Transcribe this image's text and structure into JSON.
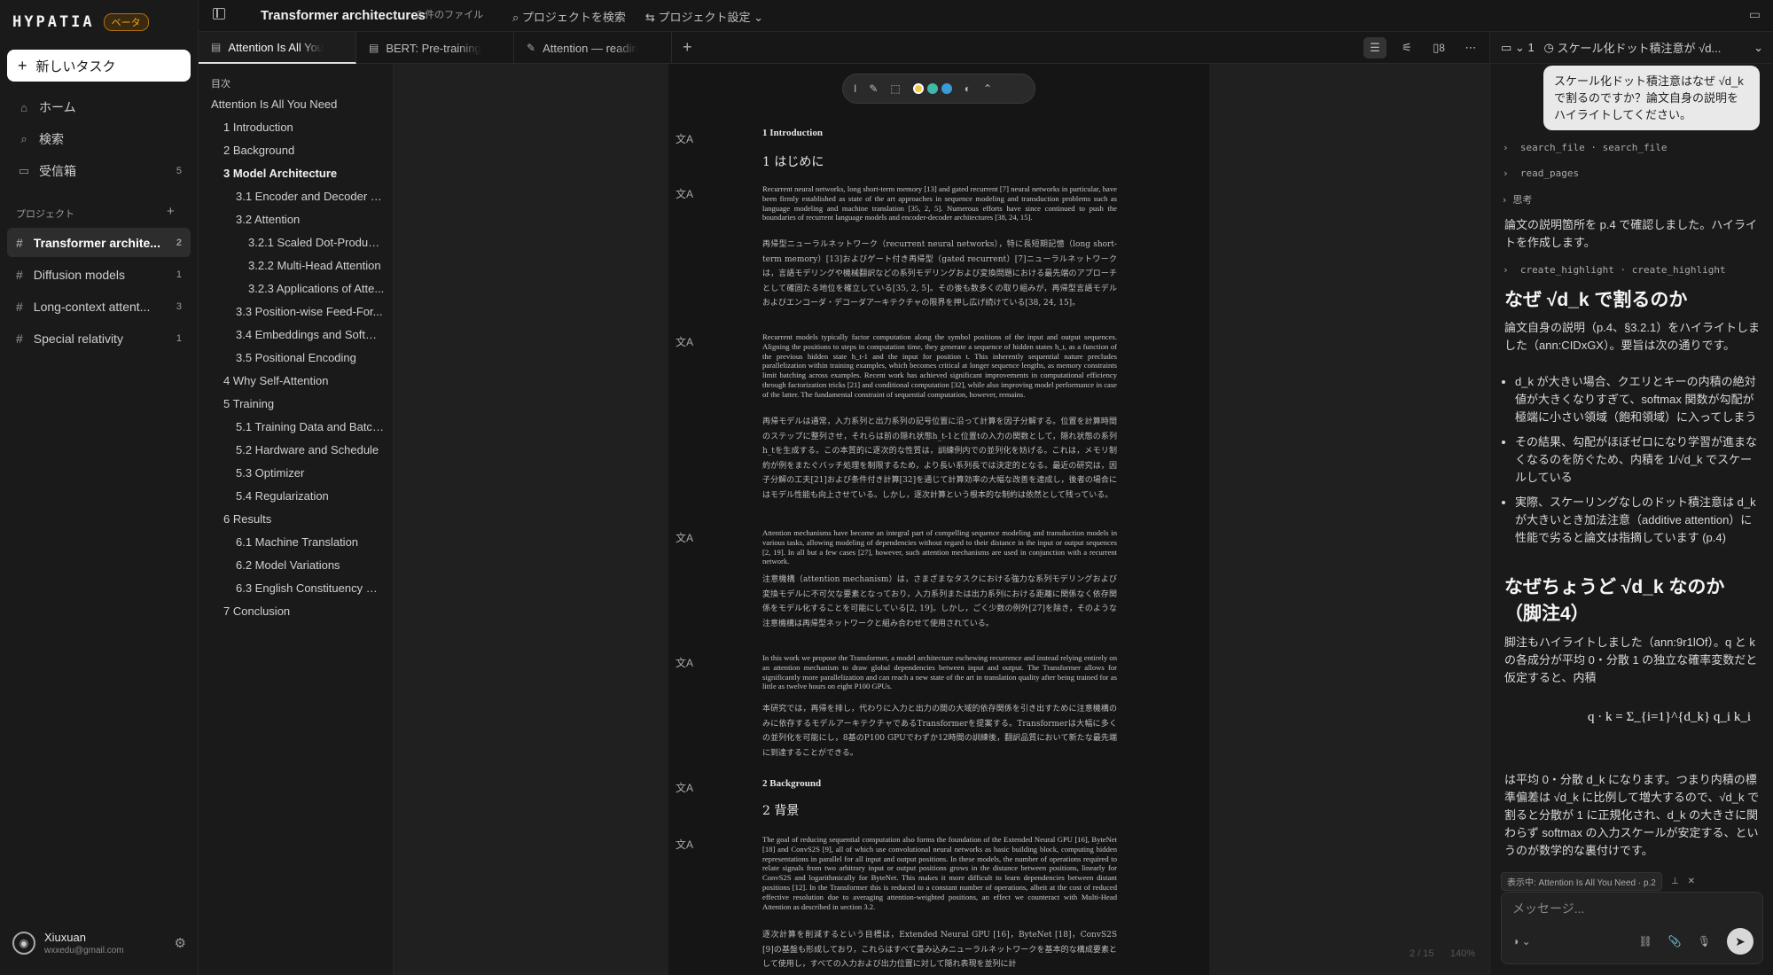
{
  "app": {
    "logo": "HYPATIA",
    "beta_badge": "ベータ"
  },
  "sidebar": {
    "new_task": "新しいタスク",
    "nav": [
      {
        "label": "ホーム",
        "icon": "home-icon"
      },
      {
        "label": "検索",
        "icon": "search-icon"
      },
      {
        "label": "受信箱",
        "icon": "inbox-icon",
        "count": "5"
      }
    ],
    "projects_label": "プロジェクト",
    "projects": [
      {
        "name": "Transformer archite...",
        "count": "2",
        "active": true
      },
      {
        "name": "Diffusion models",
        "count": "1"
      },
      {
        "name": "Long-context attent...",
        "count": "3"
      },
      {
        "name": "Special relativity",
        "count": "1"
      }
    ],
    "user": {
      "name": "Xiuxuan",
      "email": "wxxedu@gmail.com"
    }
  },
  "topbar": {
    "title": "Transformer architectures",
    "files": "2 件のファイル",
    "search": "プロジェクトを検索",
    "settings": "プロジェクト設定"
  },
  "tabs": [
    {
      "label": "Attention Is All You Need",
      "active": true
    },
    {
      "label": "BERT: Pre-training of Deep"
    },
    {
      "label": "Attention — reading notes"
    }
  ],
  "tab_tools": {
    "count": "8"
  },
  "toc": {
    "title": "目次",
    "items": [
      {
        "label": "Attention Is All You Need",
        "level": 0
      },
      {
        "label": "1 Introduction",
        "level": 1
      },
      {
        "label": "2 Background",
        "level": 1
      },
      {
        "label": "3 Model Architecture",
        "level": 1,
        "bold": true
      },
      {
        "label": "3.1 Encoder and Decoder St...",
        "level": 2
      },
      {
        "label": "3.2 Attention",
        "level": 2
      },
      {
        "label": "3.2.1 Scaled Dot-Product ...",
        "level": 3
      },
      {
        "label": "3.2.2 Multi-Head Attention",
        "level": 3
      },
      {
        "label": "3.2.3 Applications of Atte...",
        "level": 3
      },
      {
        "label": "3.3 Position-wise Feed-For...",
        "level": 2
      },
      {
        "label": "3.4 Embeddings and Softmax",
        "level": 2
      },
      {
        "label": "3.5 Positional Encoding",
        "level": 2
      },
      {
        "label": "4 Why Self-Attention",
        "level": 1
      },
      {
        "label": "5 Training",
        "level": 1
      },
      {
        "label": "5.1 Training Data and Batchi...",
        "level": 2
      },
      {
        "label": "5.2 Hardware and Schedule",
        "level": 2
      },
      {
        "label": "5.3 Optimizer",
        "level": 2
      },
      {
        "label": "5.4 Regularization",
        "level": 2
      },
      {
        "label": "6 Results",
        "level": 1
      },
      {
        "label": "6.1 Machine Translation",
        "level": 2
      },
      {
        "label": "6.2 Model Variations",
        "level": 2
      },
      {
        "label": "6.3 English Constituency Pa...",
        "level": 2
      },
      {
        "label": "7 Conclusion",
        "level": 1
      }
    ]
  },
  "document": {
    "colors": [
      "#f2c94c",
      "#3fb8a8",
      "#3b9ad9"
    ],
    "page_indicator": "2 / 15",
    "zoom": "140%",
    "blocks": {
      "h1_en": "1   Introduction",
      "h1_ja": "1 はじめに",
      "p1_en": "Recurrent neural networks, long short-term memory [13] and gated recurrent [7] neural networks in particular, have been firmly established as state of the art approaches in sequence modeling and transduction problems such as language modeling and machine translation [35, 2, 5]. Numerous efforts have since continued to push the boundaries of recurrent language models and encoder-decoder architectures [38, 24, 15].",
      "p1_ja": "再帰型ニューラルネットワーク（recurrent neural networks），特に長短期記憶（long short-term memory）[13]およびゲート付き再帰型（gated recurrent）[7]ニューラルネットワークは，言語モデリングや機械翻訳などの系列モデリングおよび変換問題における最先端のアプローチとして確固たる地位を確立している[35, 2, 5]。その後も数多くの取り組みが，再帰型言語モデルおよびエンコーダ・デコーダアーキテクチャの限界を押し広げ続けている[38, 24, 15]。",
      "p2_en": "Recurrent models typically factor computation along the symbol positions of the input and output sequences. Aligning the positions to steps in computation time, they generate a sequence of hidden states h_t, as a function of the previous hidden state h_t-1 and the input for position t. This inherently sequential nature precludes parallelization within training examples, which becomes critical at longer sequence lengths, as memory constraints limit batching across examples. Recent work has achieved significant improvements in computational efficiency through factorization tricks [21] and conditional computation [32], while also improving model performance in case of the latter. The fundamental constraint of sequential computation, however, remains.",
      "p2_ja": "再帰モデルは通常，入力系列と出力系列の記号位置に沿って計算を因子分解する。位置を計算時間のステップに整列させ，それらは前の隠れ状態h_t-1と位置tの入力の関数として，隠れ状態の系列h_tを生成する。この本質的に逐次的な性質は，訓練例内での並列化を妨げる。これは，メモリ制約が例をまたぐバッチ処理を制限するため，より長い系列長では決定的となる。最近の研究は，因子分解の工夫[21]および条件付き計算[32]を通じて計算効率の大幅な改善を達成し，後者の場合にはモデル性能も向上させている。しかし，逐次計算という根本的な制約は依然として残っている。",
      "p3_en": "Attention mechanisms have become an integral part of compelling sequence modeling and transduction models in various tasks, allowing modeling of dependencies without regard to their distance in the input or output sequences [2, 19]. In all but a few cases [27], however, such attention mechanisms are used in conjunction with a recurrent network.",
      "p3_ja": "注意機構（attention mechanism）は，さまざまなタスクにおける強力な系列モデリングおよび変換モデルに不可欠な要素となっており，入力系列または出力系列における距離に関係なく依存関係をモデル化することを可能にしている[2, 19]。しかし，ごく少数の例外[27]を除き，そのような注意機構は再帰型ネットワークと組み合わせて使用されている。",
      "p4_en": "In this work we propose the Transformer, a model architecture eschewing recurrence and instead relying entirely on an attention mechanism to draw global dependencies between input and output. The Transformer allows for significantly more parallelization and can reach a new state of the art in translation quality after being trained for as little as twelve hours on eight P100 GPUs.",
      "p4_ja": "本研究では，再帰を排し，代わりに入力と出力の間の大域的依存関係を引き出すために注意機構のみに依存するモデルアーキテクチャであるTransformerを提案する。Transformerは大幅に多くの並列化を可能にし，8基のP100 GPUでわずか12時間の訓練後，翻訳品質において新たな最先端に到達することができる。",
      "h2_en": "2   Background",
      "h2_ja": "2 背景",
      "p5_en": "The goal of reducing sequential computation also forms the foundation of the Extended Neural GPU [16], ByteNet [18] and ConvS2S [9], all of which use convolutional neural networks as basic building block, computing hidden representations in parallel for all input and output positions. In these models, the number of operations required to relate signals from two arbitrary input or output positions grows in the distance between positions, linearly for ConvS2S and logarithmically for ByteNet. This makes it more difficult to learn dependencies between distant positions [12]. In the Transformer this is reduced to a constant number of operations, albeit at the cost of reduced effective resolution due to averaging attention-weighted positions, an effect we counteract with Multi-Head Attention as described in section 3.2.",
      "p5_ja": "逐次計算を削減するという目標は，Extended Neural GPU [16]，ByteNet [18]，ConvS2S [9]の基盤も形成しており，これらはすべて畳み込みニューラルネットワークを基本的な構成要素として使用し，すべての入力および出力位置に対して隠れ表現を並列に計"
    }
  },
  "chat": {
    "header": {
      "count": "1",
      "thread_title": "スケール化ドット積注意が √d..."
    },
    "user_message": "スケール化ドット積注意はなぜ √d_k で割るのですか？論文自身の説明をハイライトしてください。",
    "tools": [
      {
        "label": "search_file · search_file"
      },
      {
        "label": "read_pages"
      },
      {
        "label": "思考"
      },
      {
        "label": "create_highlight · create_highlight"
      }
    ],
    "intro": "論文の説明箇所を p.4 で確認しました。ハイライトを作成します。",
    "heading1": "なぜ √d_k で割るのか",
    "p1": "論文自身の説明（p.4、§3.2.1）をハイライトしました（ann:CIDxGX）。要旨は次の通りです。",
    "bullets": [
      "d_k が大きい場合、クエリとキーの内積の絶対値が大きくなりすぎて、softmax 関数が勾配が極端に小さい領域（飽和領域）に入ってしまう",
      "その結果、勾配がほぼゼロになり学習が進まなくなるのを防ぐため、内積を 1/√d_k でスケールしている",
      "実際、スケーリングなしのドット積注意は d_k が大きいとき加法注意（additive attention）に性能で劣ると論文は指摘しています (p.4)"
    ],
    "heading2": "なぜちょうど √d_k なのか（脚注4）",
    "p2": "脚注もハイライトしました（ann:9r1lOf）。q と k の各成分が平均 0・分散 1 の独立な確率変数だと仮定すると、内積",
    "formula": "q · k = Σ_{i=1}^{d_k} q_i k_i",
    "p3": "は平均 0・分散 d_k になります。つまり内積の標準偏差は √d_k に比例して増大するので、√d_k で割ると分散が 1 に正規化され、d_k の大きさに関わらず softmax の入力スケールが安定する、というのが数学的な裏付けです。",
    "context_chip": "表示中: Attention Is All You Need · p.2",
    "input_placeholder": "メッセージ..."
  }
}
